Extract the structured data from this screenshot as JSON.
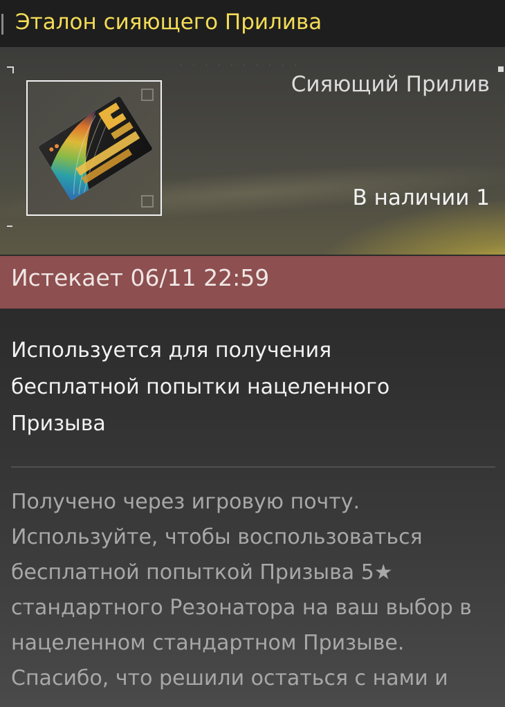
{
  "header": {
    "title": "Эталон сияющего Прилива"
  },
  "item": {
    "category": "Сияющий Прилив",
    "stock_label": "В наличии 1",
    "icon": "golden-tide-ticket-icon"
  },
  "expiry": {
    "text": "Истекает 06/11 22:59"
  },
  "usage": {
    "lines": [
      "Используется для получения",
      "бесплатной попытки нацеленного",
      "Призыва"
    ]
  },
  "description": {
    "lines": [
      "Получено через игровую почту.",
      "Используйте, чтобы воспользоваться",
      "бесплатной попыткой Призыва 5★",
      "стандартного Резонатора на ваш выбор в",
      "нацеленном стандартном Призыве.",
      "Спасибо, что решили остаться с нами и"
    ]
  },
  "colors": {
    "title_accent": "#f3dc57",
    "expiry_background": "#8d4f4f",
    "glow": "#ebd246"
  }
}
